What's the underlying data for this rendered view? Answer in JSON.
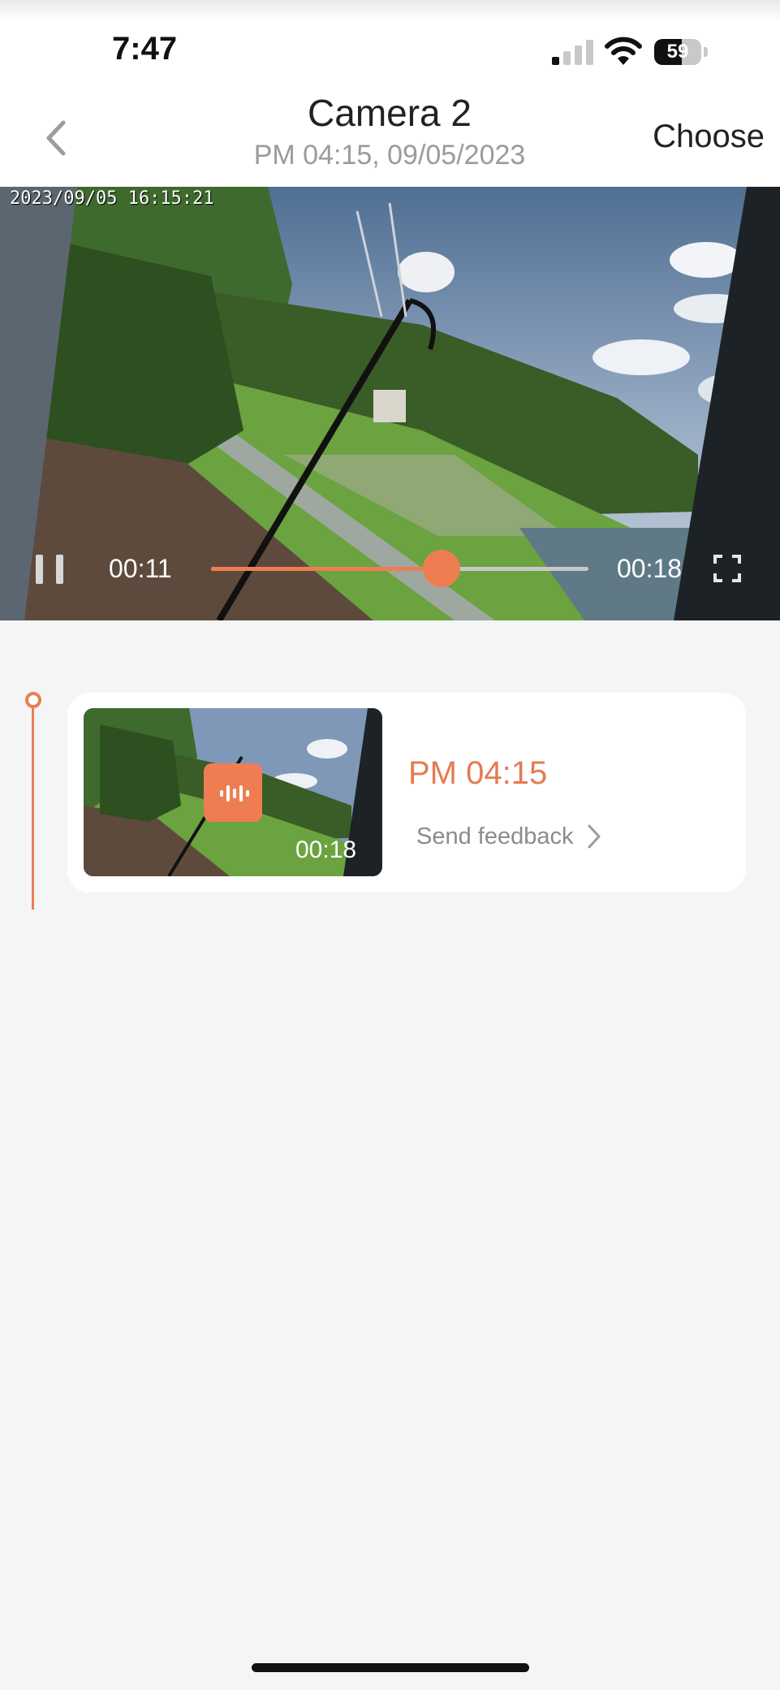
{
  "status_bar": {
    "time": "7:47",
    "battery": "59",
    "battery_fraction": 0.59,
    "signal_bars_active": 1
  },
  "header": {
    "title": "Camera 2",
    "subtitle": "PM 04:15, 09/05/2023",
    "choose_label": "Choose",
    "back_icon": "chevron-left-icon"
  },
  "player": {
    "osd_timestamp": "2023/09/05  16:15:21",
    "current_time": "00:11",
    "total_time": "00:18",
    "progress": 0.61,
    "accent": "#ee7e52",
    "pause_icon": "pause-icon",
    "fullscreen_icon": "fullscreen-icon"
  },
  "events": [
    {
      "time": "PM 04:15",
      "duration": "00:18",
      "feedback_label": "Send feedback",
      "badge_icon": "sound-wave-icon",
      "accent": "#e57b51"
    }
  ]
}
